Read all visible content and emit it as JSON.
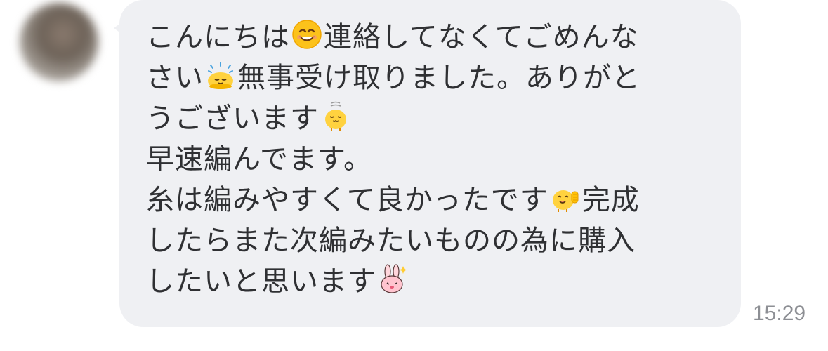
{
  "message": {
    "time": "15:29",
    "lines": [
      {
        "a": "こんにちは",
        "b": "連絡してなくてごめんな"
      },
      {
        "a": "さい",
        "b": "無事受け取りました。ありがと"
      },
      {
        "a": "うございます"
      },
      {
        "a": "早速編んでます。"
      },
      {
        "a": "糸は編みやすくて良かったです",
        "b": "完成"
      },
      {
        "a": "したらまた次編みたいものの為に購入"
      },
      {
        "a": "したいと思います"
      }
    ]
  },
  "icons": {
    "smile": "smiling-face-emoji",
    "chick_bow": "chick-bowing-emoji",
    "chick_bell": "chick-emoji",
    "chick_thumbs": "chick-thumbs-up-emoji",
    "rabbit": "pink-rabbit-sparkle-emoji"
  },
  "colors": {
    "bubble": "#eff0f3",
    "text": "#2f3033",
    "time": "#8d8f94"
  }
}
